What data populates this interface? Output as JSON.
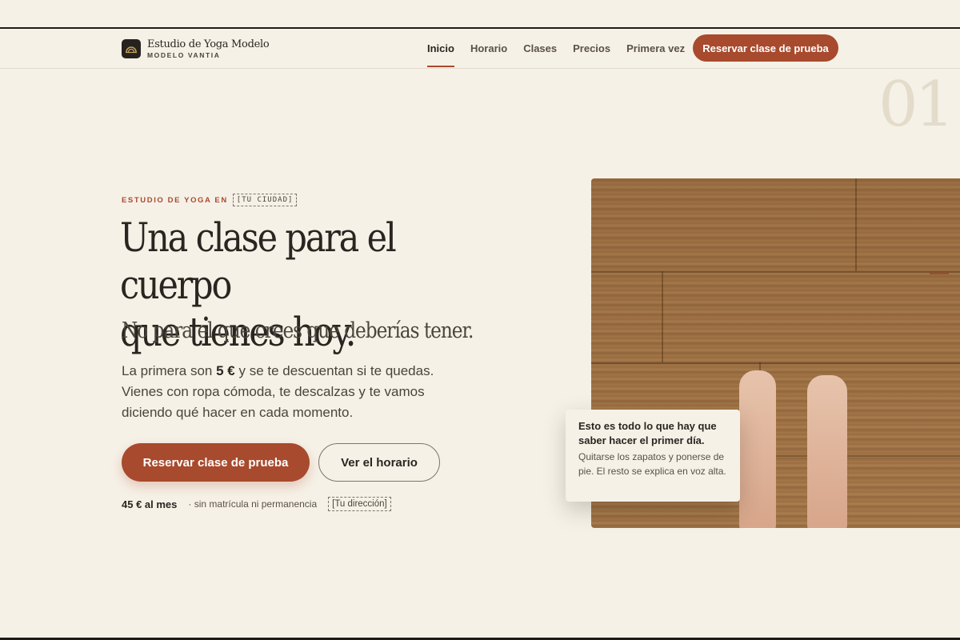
{
  "brand": {
    "name": "Estudio de Yoga Modelo",
    "subtitle": "MODELO VANTIA"
  },
  "nav": {
    "items": [
      {
        "label": "Inicio",
        "active": true
      },
      {
        "label": "Horario",
        "active": false
      },
      {
        "label": "Clases",
        "active": false
      },
      {
        "label": "Precios",
        "active": false
      },
      {
        "label": "Primera vez",
        "active": false
      }
    ],
    "cta_label": "Reservar clase de prueba"
  },
  "hero": {
    "section_number": "01",
    "eyebrow": "ESTUDIO DE YOGA EN",
    "city_placeholder": "[TU CIUDAD]",
    "title_line1": "Una clase para el cuerpo",
    "title_line2": "que tienes hoy.",
    "subtitle": "No para el que crees que deberías tener.",
    "body_before_price": "La primera son ",
    "body_price": "5 €",
    "body_after_price": " y se te descuentan si te quedas. Vienes con ropa cómoda, te descalzas y te vamos diciendo qué hacer en cada momento.",
    "primary_button": "Reservar clase de prueba",
    "secondary_button": "Ver el horario",
    "monthly_price": "45 € al mes",
    "price_note": "· sin matrícula ni permanencia",
    "address_placeholder": "[Tu dirección]"
  },
  "photo_caption": {
    "title": "Esto es todo lo que hay que saber hacer el primer día.",
    "text": "Quitarse los zapatos y ponerse de pie. El resto se explica en voz alta."
  },
  "colors": {
    "accent": "#a84a2d",
    "background": "#f6f1e7",
    "text": "#2a2520"
  }
}
